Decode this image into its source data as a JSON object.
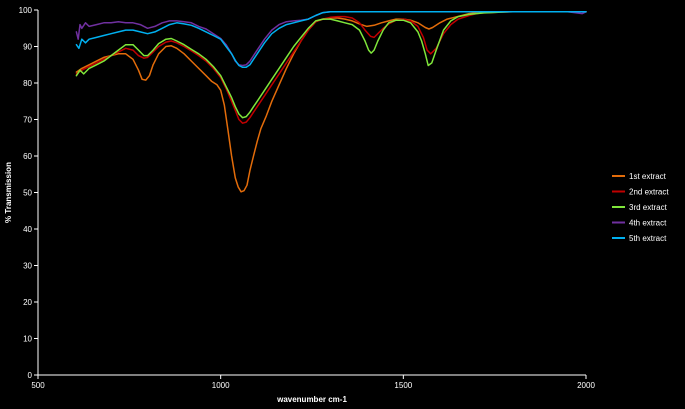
{
  "chart_data": {
    "type": "line",
    "title": "",
    "xlabel": "wavenumber cm-1",
    "ylabel": "% Transmission",
    "xlim": [
      500,
      2000
    ],
    "ylim": [
      0,
      100
    ],
    "x_ticks": [
      500,
      1000,
      1500,
      2000
    ],
    "y_ticks": [
      0,
      10,
      20,
      30,
      40,
      50,
      60,
      70,
      80,
      90,
      100
    ],
    "grid": false,
    "legend_position": "right",
    "background_color": "#000000",
    "axis_color": "#ffffff",
    "series": [
      {
        "name": "1st extract",
        "color": "#e36c0a",
        "x": [
          605,
          620,
          640,
          660,
          680,
          700,
          720,
          740,
          760,
          775,
          785,
          795,
          805,
          815,
          830,
          850,
          865,
          880,
          900,
          920,
          940,
          960,
          975,
          990,
          1000,
          1010,
          1020,
          1030,
          1040,
          1048,
          1056,
          1064,
          1072,
          1080,
          1090,
          1100,
          1110,
          1125,
          1140,
          1160,
          1180,
          1200,
          1220,
          1240,
          1260,
          1280,
          1300,
          1320,
          1340,
          1360,
          1380,
          1400,
          1420,
          1440,
          1460,
          1480,
          1500,
          1520,
          1540,
          1560,
          1570,
          1580,
          1600,
          1620,
          1640,
          1660,
          1680,
          1700,
          1720,
          1740,
          1760,
          1800,
          1850,
          1900,
          1950,
          2000
        ],
        "y": [
          83,
          84,
          85,
          86,
          87,
          87.5,
          88,
          88,
          86.5,
          83.5,
          81,
          80.8,
          82,
          85,
          88,
          90,
          90.2,
          89.5,
          88,
          86,
          84,
          82,
          80.5,
          79.5,
          78,
          74,
          67,
          60,
          54,
          51.5,
          50.2,
          50.5,
          52,
          56,
          60,
          64,
          67.5,
          71,
          75,
          79.5,
          84,
          88,
          91.5,
          94.5,
          96.8,
          97.5,
          97.8,
          97.8,
          97.5,
          97,
          96.2,
          95.5,
          95.8,
          96.5,
          97,
          97.5,
          97.5,
          97.2,
          96.5,
          95.2,
          94.8,
          95.2,
          96.5,
          97.5,
          98,
          98.5,
          99,
          99.2,
          99.3,
          99.4,
          99.5,
          99.5,
          99.5,
          99.5,
          99.5,
          99.5
        ]
      },
      {
        "name": "2nd extract",
        "color": "#c00000",
        "x": [
          605,
          620,
          640,
          660,
          680,
          700,
          720,
          740,
          760,
          775,
          790,
          800,
          815,
          830,
          850,
          865,
          880,
          900,
          920,
          940,
          960,
          980,
          1000,
          1015,
          1030,
          1040,
          1050,
          1060,
          1070,
          1080,
          1090,
          1100,
          1120,
          1140,
          1160,
          1180,
          1200,
          1220,
          1240,
          1260,
          1280,
          1300,
          1320,
          1340,
          1360,
          1380,
          1395,
          1410,
          1420,
          1430,
          1445,
          1460,
          1480,
          1500,
          1520,
          1540,
          1555,
          1565,
          1575,
          1590,
          1610,
          1630,
          1650,
          1680,
          1700,
          1720,
          1740,
          1760,
          1800,
          1850,
          1900,
          1950,
          2000
        ],
        "y": [
          82.5,
          83.5,
          84.5,
          85.5,
          86.5,
          87.5,
          88.5,
          89.5,
          89,
          87.5,
          86.8,
          87,
          88.5,
          90,
          91.2,
          91.5,
          91,
          90,
          88.8,
          87.5,
          86,
          84,
          81.5,
          78.5,
          75,
          72.5,
          70,
          69,
          69.3,
          70.5,
          72,
          73.5,
          76.5,
          79.5,
          82.5,
          85.5,
          88.5,
          91.5,
          94.5,
          96.8,
          97.5,
          98,
          98.2,
          98.2,
          97.8,
          96.5,
          94.5,
          92.8,
          92.5,
          93.5,
          95,
          96.2,
          97.2,
          97.5,
          97,
          95.5,
          92.5,
          89,
          88,
          89.5,
          93.5,
          96,
          97.5,
          98.5,
          99,
          99.2,
          99.3,
          99.4,
          99.5,
          99.5,
          99.5,
          99.5,
          99.5
        ]
      },
      {
        "name": "3rd extract",
        "color": "#7fe63a",
        "x": [
          605,
          615,
          625,
          640,
          660,
          680,
          700,
          720,
          740,
          760,
          775,
          790,
          800,
          815,
          830,
          850,
          865,
          880,
          900,
          920,
          940,
          960,
          980,
          1000,
          1015,
          1030,
          1040,
          1050,
          1060,
          1070,
          1080,
          1090,
          1100,
          1120,
          1140,
          1160,
          1180,
          1200,
          1220,
          1240,
          1260,
          1280,
          1300,
          1320,
          1340,
          1360,
          1380,
          1395,
          1405,
          1412,
          1420,
          1430,
          1445,
          1460,
          1480,
          1500,
          1520,
          1540,
          1550,
          1560,
          1568,
          1578,
          1590,
          1610,
          1630,
          1650,
          1680,
          1700,
          1720,
          1740,
          1760,
          1800,
          1850,
          1900,
          1950,
          2000
        ],
        "y": [
          82,
          83.5,
          82.5,
          84,
          85,
          86,
          87.5,
          89,
          90.5,
          90.5,
          89,
          87.5,
          87.5,
          89,
          90.8,
          92,
          92.2,
          91.5,
          90.5,
          89.2,
          88,
          86.5,
          84.5,
          82,
          79,
          76,
          73.5,
          71.5,
          70.5,
          70.8,
          72,
          73.5,
          75,
          78,
          81,
          84,
          87,
          90,
          92.5,
          95,
          97,
          97.5,
          97.5,
          97,
          96.5,
          96,
          94.5,
          91.5,
          89,
          88.2,
          89,
          91.5,
          94.5,
          96.5,
          97.2,
          97.2,
          96.5,
          94,
          91.5,
          88,
          84.8,
          85.5,
          89,
          94.5,
          97,
          98.2,
          98.8,
          99,
          99.2,
          99.3,
          99.4,
          99.5,
          99.5,
          99.5,
          99.5,
          99.5
        ]
      },
      {
        "name": "4th extract",
        "color": "#7030a0",
        "x": [
          605,
          610,
          615,
          620,
          630,
          640,
          660,
          680,
          700,
          720,
          740,
          760,
          780,
          800,
          820,
          840,
          860,
          880,
          900,
          920,
          940,
          960,
          980,
          1000,
          1015,
          1030,
          1040,
          1050,
          1060,
          1070,
          1080,
          1090,
          1100,
          1120,
          1140,
          1160,
          1180,
          1200,
          1220,
          1240,
          1260,
          1280,
          1300,
          1350,
          1400,
          1450,
          1500,
          1550,
          1600,
          1650,
          1700,
          1750,
          1800,
          1850,
          1900,
          1950,
          1990,
          2000
        ],
        "y": [
          94,
          92,
          96,
          95,
          96.5,
          95.5,
          96,
          96.5,
          96.5,
          96.8,
          96.5,
          96.5,
          96,
          95,
          95.5,
          96.5,
          97,
          97,
          96.8,
          96.5,
          95.5,
          94.8,
          93.5,
          92.2,
          90.5,
          88,
          86,
          85,
          84.8,
          85,
          86,
          87.5,
          89,
          92,
          94.5,
          96,
          96.8,
          97,
          97.2,
          97.5,
          98.5,
          99.3,
          99.5,
          99.5,
          99.5,
          99.5,
          99.5,
          99.5,
          99.5,
          99.5,
          99.5,
          99.5,
          99.5,
          99.5,
          99.5,
          99.5,
          99,
          99.5
        ]
      },
      {
        "name": "5th extract",
        "color": "#00b0f0",
        "x": [
          605,
          612,
          620,
          630,
          640,
          660,
          680,
          700,
          720,
          740,
          760,
          780,
          800,
          820,
          840,
          860,
          880,
          900,
          920,
          940,
          960,
          980,
          1000,
          1015,
          1030,
          1040,
          1050,
          1060,
          1070,
          1080,
          1090,
          1100,
          1120,
          1140,
          1160,
          1180,
          1200,
          1220,
          1240,
          1260,
          1280,
          1300,
          1350,
          1400,
          1450,
          1500,
          1550,
          1600,
          1650,
          1700,
          1750,
          1800,
          1850,
          1900,
          1950,
          2000
        ],
        "y": [
          90.5,
          89.5,
          92,
          91,
          92,
          92.5,
          93,
          93.5,
          94,
          94.5,
          94.5,
          94,
          93.5,
          94,
          95,
          96,
          96.5,
          96.2,
          95.8,
          95,
          94,
          93,
          92,
          90,
          88,
          86.2,
          84.8,
          84.3,
          84.3,
          85,
          86.5,
          88,
          91,
          93.5,
          95,
          96,
          96.5,
          97,
          97.5,
          98.5,
          99.3,
          99.5,
          99.5,
          99.5,
          99.5,
          99.5,
          99.5,
          99.5,
          99.5,
          99.5,
          99.5,
          99.5,
          99.5,
          99.5,
          99.5,
          99.5
        ]
      }
    ]
  }
}
